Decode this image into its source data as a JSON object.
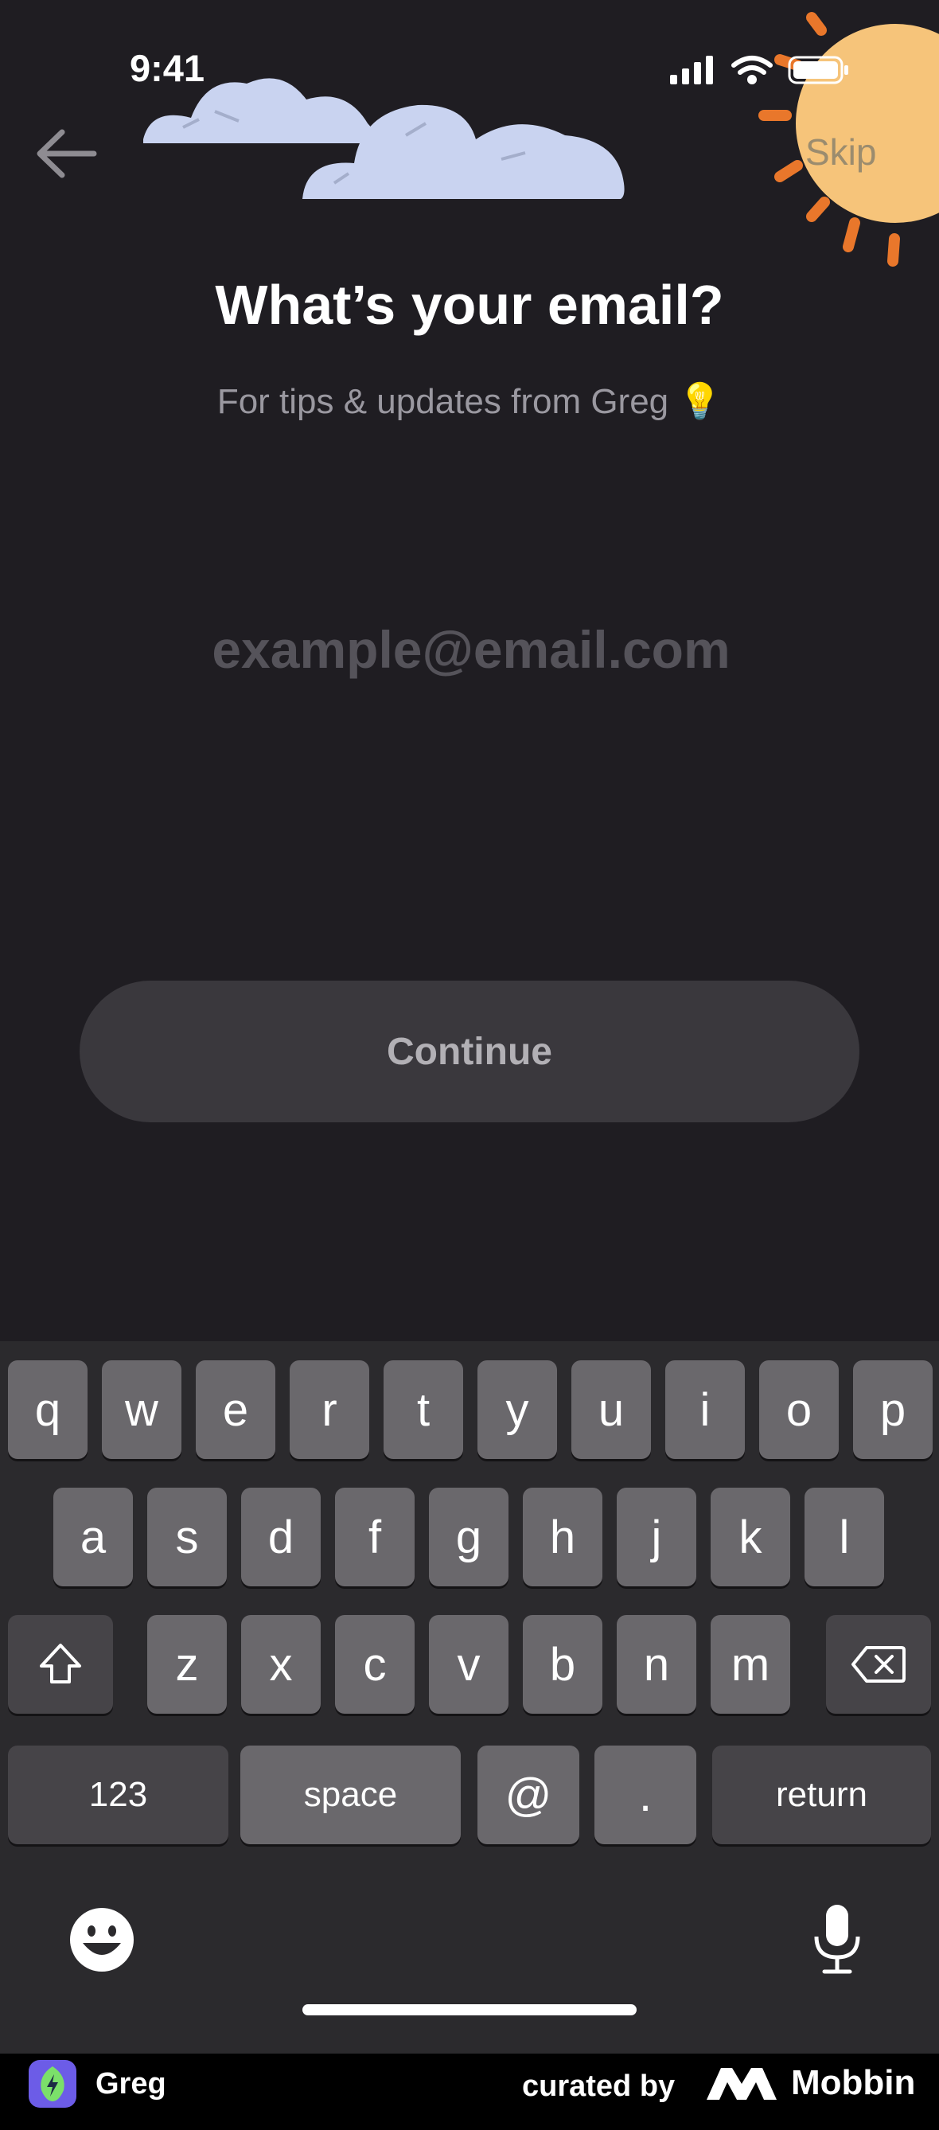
{
  "status_bar": {
    "time": "9:41"
  },
  "header": {
    "skip_label": "Skip"
  },
  "main": {
    "title": "What’s your email?",
    "subtitle": "For tips & updates from Greg",
    "email_value": "",
    "email_placeholder": "example@email.com",
    "continue_label": "Continue"
  },
  "keyboard": {
    "row1": [
      "q",
      "w",
      "e",
      "r",
      "t",
      "y",
      "u",
      "i",
      "o",
      "p"
    ],
    "row2": [
      "a",
      "s",
      "d",
      "f",
      "g",
      "h",
      "j",
      "k",
      "l"
    ],
    "row3": [
      "z",
      "x",
      "c",
      "v",
      "b",
      "n",
      "m"
    ],
    "numbers_label": "123",
    "space_label": "space",
    "at_label": "@",
    "dot_label": ".",
    "return_label": "return"
  },
  "footer": {
    "app_name": "Greg",
    "curated_by": "curated by",
    "brand": "Mobbin"
  },
  "colors": {
    "background": "#1f1d22",
    "button": "#3a383d",
    "key": "#6a686c",
    "sun": "#f6c47a",
    "sun_rays": "#e9772b",
    "cloud": "#c9d3f0",
    "app_icon": "#6c5ce7"
  }
}
